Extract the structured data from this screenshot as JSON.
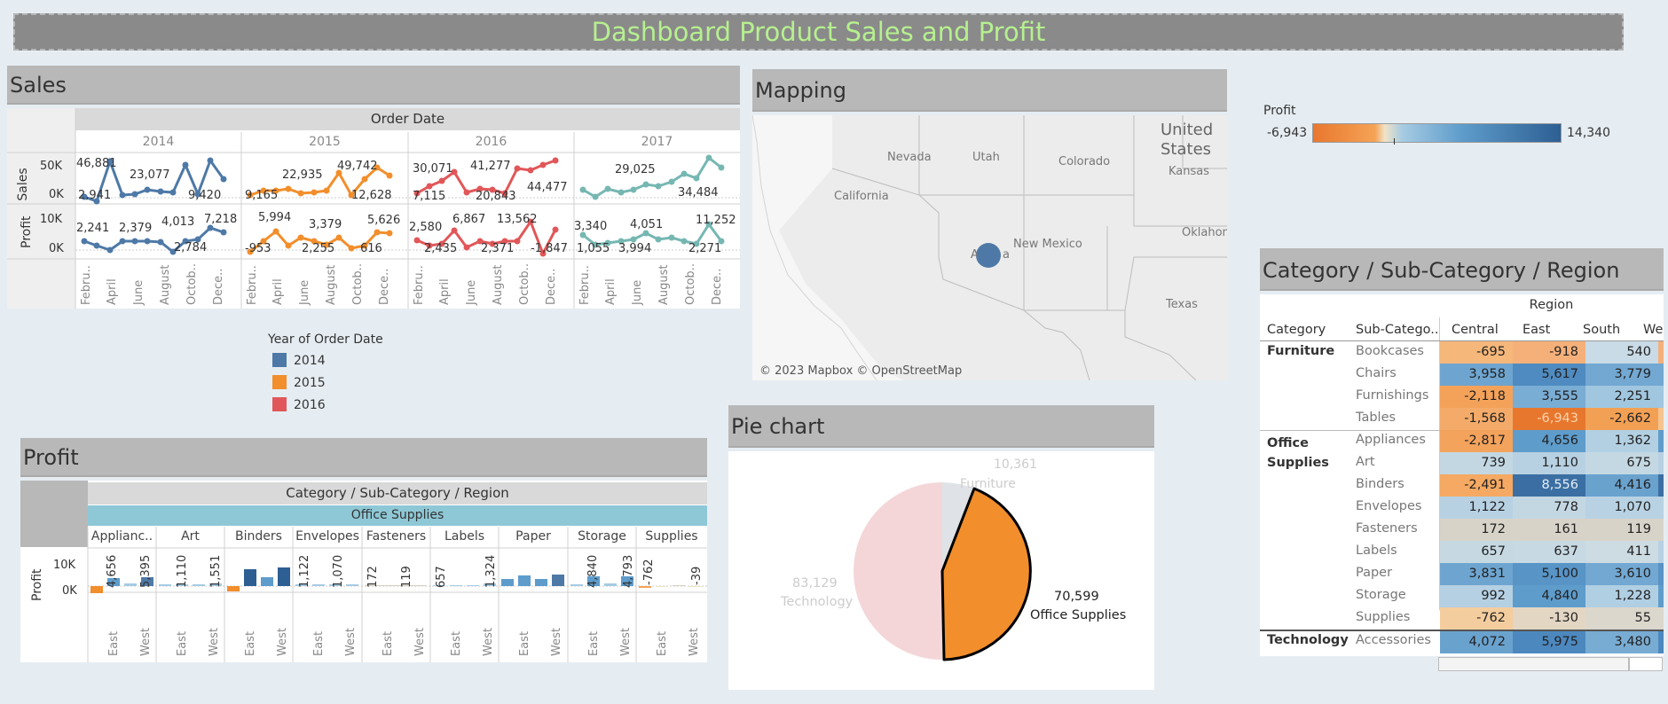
{
  "dashboard": {
    "title": "Dashboard Product Sales and Profit"
  },
  "sales": {
    "title": "Sales",
    "order_date_label": "Order Date",
    "years": [
      "2014",
      "2015",
      "2016",
      "2017"
    ],
    "row_labels": [
      "Sales",
      "Profit"
    ],
    "sales_ticks": [
      "50K",
      "0K"
    ],
    "profit_ticks": [
      "10K",
      "0K"
    ],
    "month_labels": [
      "Febru..",
      "April",
      "June",
      "August",
      "Octob..",
      "Dece.."
    ],
    "sales_annotations": [
      [
        "46,881",
        "2,941",
        "23,077",
        "9,420"
      ],
      [
        "22,935",
        "9,165",
        "49,742",
        "12,628"
      ],
      [
        "30,071",
        "7,115",
        "41,277",
        "20,843",
        "44,477"
      ],
      [
        "29,025",
        "34,484"
      ]
    ],
    "profit_annotations": [
      [
        "2,241",
        "2,379",
        "4,013",
        "2,784",
        "7,218"
      ],
      [
        "5,994",
        "-953",
        "3,379",
        "2,255",
        "616",
        "5,626"
      ],
      [
        "2,580",
        "2,435",
        "6,867",
        "2,371",
        "13,562",
        "-1,847"
      ],
      [
        "3,340",
        "1,055",
        "3,994",
        "4,051",
        "2,271",
        "11,252"
      ]
    ]
  },
  "legend": {
    "title": "Year of Order Date",
    "items": [
      {
        "label": "2014",
        "color": "#4e79a7"
      },
      {
        "label": "2015",
        "color": "#f28e2b"
      },
      {
        "label": "2016",
        "color": "#e15759"
      }
    ]
  },
  "mapping": {
    "title": "Mapping",
    "labels": [
      "Nevada",
      "Utah",
      "Colorado",
      "California",
      "Kansas",
      "Oklahom",
      "New Mexico",
      "Texas",
      "United States",
      "A",
      "a"
    ],
    "attribution": "© 2023 Mapbox © OpenStreetMap"
  },
  "profit_legend": {
    "title": "Profit",
    "min": "-6,943",
    "max": "14,340"
  },
  "profit": {
    "title": "Profit",
    "header": "Category / Sub-Category / Region",
    "category": "Office Supplies",
    "row_label": "Profit",
    "ticks": [
      "10K",
      "0K"
    ],
    "subcats": [
      "Applianc..",
      "Art",
      "Binders",
      "Envelopes",
      "Fasteners",
      "Labels",
      "Paper",
      "Storage",
      "Supplies"
    ],
    "bar_labels": [
      [
        "4,656",
        "5,395"
      ],
      [
        "1,110",
        "1,551"
      ],
      [],
      [
        "1,122",
        "1,070"
      ],
      [
        "172",
        "119"
      ],
      [
        "657",
        "1,324"
      ],
      [],
      [
        "4,840",
        "4,793"
      ],
      [
        "-762",
        "-39"
      ]
    ],
    "region_labels": [
      "East",
      "West"
    ]
  },
  "pie": {
    "title": "Pie chart",
    "slices": [
      {
        "value": "10,361",
        "label": "Furniture"
      },
      {
        "value": "70,599",
        "label": "Office Supplies"
      },
      {
        "value": "83,129",
        "label": "Technology"
      }
    ]
  },
  "heatmap": {
    "title": "Category / Sub-Category / Region",
    "region_header": "Region",
    "col_headers": [
      "Category",
      "Sub-Catego..",
      "Central",
      "East",
      "South",
      "We"
    ],
    "categories": [
      {
        "name": "Furniture",
        "rows": [
          {
            "sub": "Bookcases",
            "vals": [
              "-695",
              "-918",
              "540"
            ]
          },
          {
            "sub": "Chairs",
            "vals": [
              "3,958",
              "5,617",
              "3,779"
            ]
          },
          {
            "sub": "Furnishings",
            "vals": [
              "-2,118",
              "3,555",
              "2,251"
            ]
          },
          {
            "sub": "Tables",
            "vals": [
              "-1,568",
              "-6,943",
              "-2,662"
            ]
          }
        ]
      },
      {
        "name": "Office Supplies",
        "rows": [
          {
            "sub": "Appliances",
            "vals": [
              "-2,817",
              "4,656",
              "1,362"
            ]
          },
          {
            "sub": "Art",
            "vals": [
              "739",
              "1,110",
              "675"
            ]
          },
          {
            "sub": "Binders",
            "vals": [
              "-2,491",
              "8,556",
              "4,416"
            ]
          },
          {
            "sub": "Envelopes",
            "vals": [
              "1,122",
              "778",
              "1,070"
            ]
          },
          {
            "sub": "Fasteners",
            "vals": [
              "172",
              "161",
              "119"
            ]
          },
          {
            "sub": "Labels",
            "vals": [
              "657",
              "637",
              "411"
            ]
          },
          {
            "sub": "Paper",
            "vals": [
              "3,831",
              "5,100",
              "3,610"
            ]
          },
          {
            "sub": "Storage",
            "vals": [
              "992",
              "4,840",
              "1,228"
            ]
          },
          {
            "sub": "Supplies",
            "vals": [
              "-762",
              "-130",
              "55"
            ]
          }
        ]
      },
      {
        "name": "Technology",
        "rows": [
          {
            "sub": "Accessories",
            "vals": [
              "4,072",
              "5,975",
              "3,480"
            ]
          }
        ]
      }
    ]
  }
}
